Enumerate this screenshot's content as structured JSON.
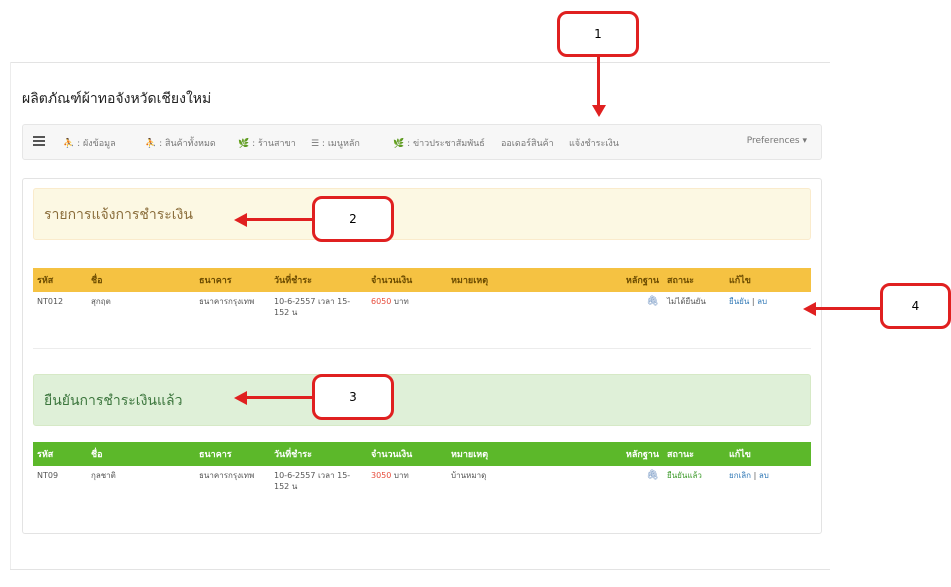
{
  "page": {
    "title": "ผลิตภัณฑ์ผ้าทอจังหวัดเชียงใหม่"
  },
  "navbar": {
    "items": [
      {
        "icon": "user-icon",
        "label": "⛹ : ผังข้อมูล"
      },
      {
        "icon": "user-icon",
        "label": "⛹ : สินค้าทั้งหมด"
      },
      {
        "icon": "leaf-icon",
        "label": "🌿 : ร้านสาขา"
      },
      {
        "icon": "list-icon",
        "label": "☰ : เมนูหลัก"
      },
      {
        "icon": "leaf-icon",
        "label": "🌿 : ข่าวประชาสัมพันธ์"
      },
      {
        "icon": "",
        "label": "ออเดอร์สินค้า"
      },
      {
        "icon": "",
        "label": "แจ้งชำระเงิน"
      }
    ],
    "preferences": "Preferences ▾"
  },
  "pending": {
    "heading": "รายการแจ้งการชำระเงิน",
    "columns": [
      "รหัส",
      "ชื่อ",
      "ธนาคาร",
      "วันที่ชำระ",
      "จำนวนเงิน",
      "หมายเหตุ",
      "หลักฐาน",
      "สถานะ",
      "แก้ไข"
    ],
    "rows": [
      {
        "code": "NT012",
        "name": "สุกฤต",
        "bank": "ธนาคารกรุงเทพ",
        "date": "10-6-2557 เวลา 15-152 น",
        "amount": "6050",
        "unit": "บาท",
        "note": "",
        "status": "ไม่ได้ยืนยัน",
        "action1": "ยืนยัน",
        "sep": "|",
        "action2": "ลบ"
      }
    ]
  },
  "confirmed": {
    "heading": "ยืนยันการชำระเงินแล้ว",
    "columns": [
      "รหัส",
      "ชื่อ",
      "ธนาคาร",
      "วันที่ชำระ",
      "จำนวนเงิน",
      "หมายเหตุ",
      "หลักฐาน",
      "สถานะ",
      "แก้ไข"
    ],
    "rows": [
      {
        "code": "NT09",
        "name": "กุลชาติ",
        "bank": "ธนาคารกรุงเทพ",
        "date": "10-6-2557 เวลา 15-152 น",
        "amount": "3050",
        "unit": "บาท",
        "note": "บ้านหมาดุ",
        "status": "ยืนยันแล้ว",
        "action1": "ยกเลิก",
        "sep": "|",
        "action2": "ลบ"
      }
    ]
  },
  "callouts": {
    "c1": "1",
    "c2": "2",
    "c3": "3",
    "c4": "4"
  },
  "colors": {
    "callout": "#e02020",
    "warning_header": "#f5c242",
    "success_header": "#5cb82a",
    "amount": "#e74c3c"
  }
}
